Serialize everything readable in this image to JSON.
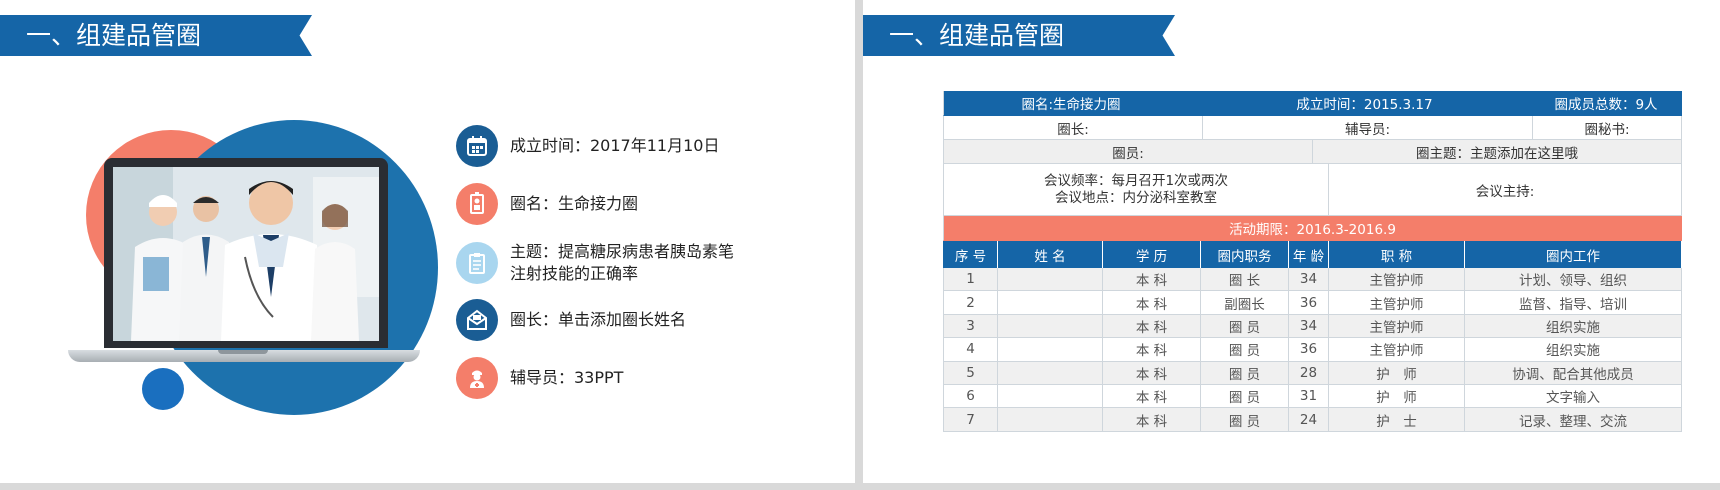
{
  "slide1": {
    "title": "一、组建品管圈",
    "info": [
      {
        "icon": "calendar-icon",
        "text": "成立时间：2017年11月10日",
        "color": "#1a5d94"
      },
      {
        "icon": "id-card-icon",
        "text": "圈名：生命接力圈",
        "color": "#f47e6a"
      },
      {
        "icon": "clipboard-icon",
        "text": "主题：提高糖尿病患者胰岛素笔注射技能的正确率",
        "color": "#a9d6ef"
      },
      {
        "icon": "mail-icon",
        "text": "圈长：单击添加圈长姓名",
        "color": "#1a5d94"
      },
      {
        "icon": "nurse-icon",
        "text": "辅导员：33PPT",
        "color": "#f47e6a"
      }
    ]
  },
  "slide2": {
    "title": "一、组建品管圈",
    "table": {
      "circle_name": "圈名:生命接力圈",
      "founded": "成立时间：2015.3.17",
      "member_total": "圈成员总数：9人",
      "leader": "圈长:",
      "counselor": "辅导员:",
      "secretary": "圈秘书:",
      "members": "圈员:",
      "theme": "圈主题：主题添加在这里哦",
      "meeting_freq": "会议频率：每月召开1次或两次",
      "meeting_place": "会议地点：内分泌科室教室",
      "meeting_host": "会议主持:",
      "period": "活动期限：2016.3-2016.9",
      "columns": [
        "序 号",
        "姓 名",
        "学 历",
        "圈内职务",
        "年 龄",
        "职 称",
        "圈内工作"
      ],
      "rows": [
        [
          "1",
          "",
          "本 科",
          "圈 长",
          "34",
          "主管护师",
          "计划、领导、组织"
        ],
        [
          "2",
          "",
          "本 科",
          "副圈长",
          "36",
          "主管护师",
          "监督、指导、培训"
        ],
        [
          "3",
          "",
          "本 科",
          "圈 员",
          "34",
          "主管护师",
          "组织实施"
        ],
        [
          "4",
          "",
          "本 科",
          "圈 员",
          "36",
          "主管护师",
          "组织实施"
        ],
        [
          "5",
          "",
          "本 科",
          "圈 员",
          "28",
          "护　师",
          "协调、配合其他成员"
        ],
        [
          "6",
          "",
          "本 科",
          "圈 员",
          "31",
          "护　师",
          "文字输入"
        ],
        [
          "7",
          "",
          "本 科",
          "圈 员",
          "24",
          "护　士",
          "记录、整理、交流"
        ]
      ]
    }
  },
  "colors": {
    "brand_blue": "#1565a7",
    "accent_salmon": "#f47e6a"
  }
}
